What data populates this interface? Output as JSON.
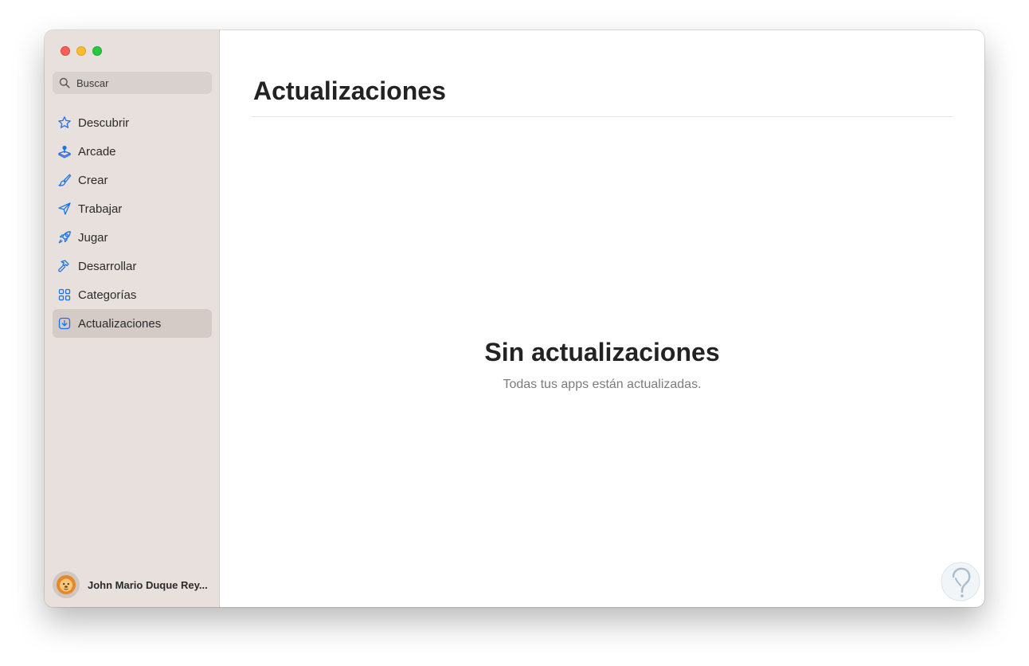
{
  "window": {
    "traffic_lights": [
      "close",
      "minimize",
      "zoom"
    ]
  },
  "sidebar": {
    "search": {
      "placeholder": "Buscar",
      "icon": "search-icon"
    },
    "items": [
      {
        "label": "Descubrir",
        "icon": "star-icon",
        "active": false
      },
      {
        "label": "Arcade",
        "icon": "joystick-icon",
        "active": false
      },
      {
        "label": "Crear",
        "icon": "paintbrush-icon",
        "active": false
      },
      {
        "label": "Trabajar",
        "icon": "paperplane-icon",
        "active": false
      },
      {
        "label": "Jugar",
        "icon": "rocket-icon",
        "active": false
      },
      {
        "label": "Desarrollar",
        "icon": "hammer-icon",
        "active": false
      },
      {
        "label": "Categorías",
        "icon": "grid-icon",
        "active": false
      },
      {
        "label": "Actualizaciones",
        "icon": "download-icon",
        "active": true
      }
    ],
    "account": {
      "name": "John Mario Duque Rey...",
      "avatar_icon": "lion-memoji-icon"
    }
  },
  "main": {
    "title": "Actualizaciones",
    "empty_state": {
      "title": "Sin actualizaciones",
      "subtitle": "Todas tus apps están actualizadas."
    }
  },
  "colors": {
    "accent": "#1a73e8",
    "sidebar_bg": "#e8e0dc",
    "active_item_bg": "#d4cbc7",
    "title_text": "#232323",
    "secondary_text": "#7c7c7c"
  }
}
